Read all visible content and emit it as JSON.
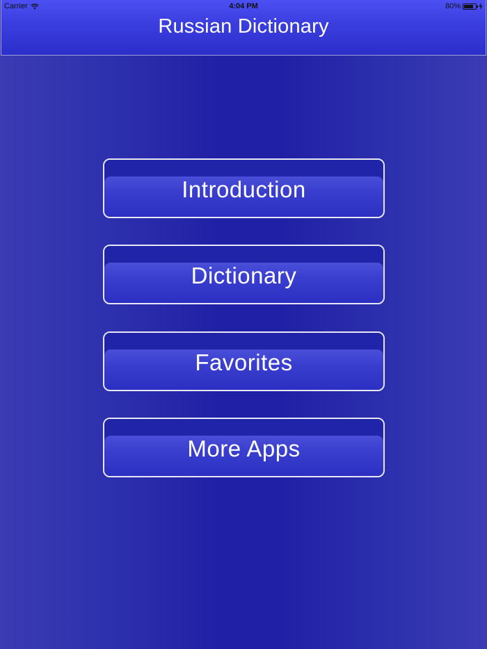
{
  "status_bar": {
    "carrier": "Carrier",
    "time": "4:04 PM",
    "battery_percent": "80%",
    "battery_level": 0.8,
    "wifi_icon": "wifi-icon",
    "charging_icon": "bolt-icon"
  },
  "nav": {
    "title": "Russian Dictionary"
  },
  "menu": {
    "items": [
      {
        "label": "Introduction"
      },
      {
        "label": "Dictionary"
      },
      {
        "label": "Favorites"
      },
      {
        "label": "More Apps"
      }
    ]
  },
  "colors": {
    "background": "#2020a6",
    "nav_bar": "#3c3fe0",
    "button_border": "#e8e8f5",
    "text": "#ffffff"
  }
}
